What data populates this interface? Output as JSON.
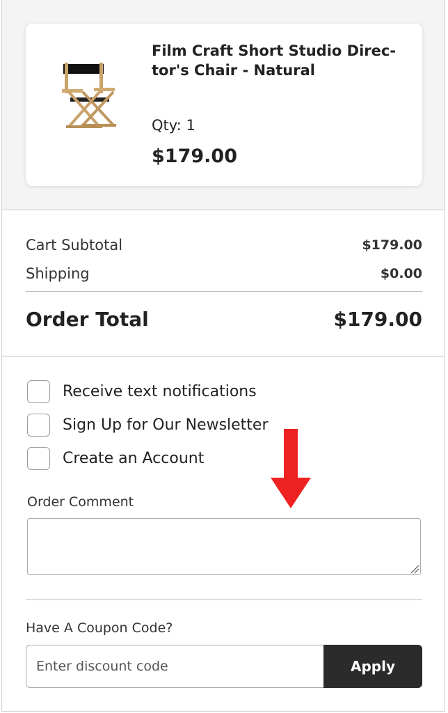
{
  "product": {
    "name": "Film Craft Short Studio Direc-tor's Chair - Natural",
    "image_icon": "directors-chair-image",
    "qty_label": "Qty:",
    "qty_value": "1",
    "price": "$179.00"
  },
  "totals": {
    "subtotal_label": "Cart Subtotal",
    "subtotal_value": "$179.00",
    "shipping_label": "Shipping",
    "shipping_value": "$0.00",
    "order_total_label": "Order Total",
    "order_total_value": "$179.00"
  },
  "options": [
    {
      "label": "Receive text notifications",
      "checked": false
    },
    {
      "label": "Sign Up for Our Newsletter",
      "checked": false
    },
    {
      "label": "Create an Account",
      "checked": false
    }
  ],
  "comment": {
    "label": "Order Comment",
    "value": ""
  },
  "coupon": {
    "label": "Have A Coupon Code?",
    "placeholder": "Enter discount code",
    "apply_label": "Apply"
  },
  "colors": {
    "top_background": "#f4f4f4",
    "button_background": "#2b2b2b",
    "annotation_arrow": "#ee2222"
  }
}
